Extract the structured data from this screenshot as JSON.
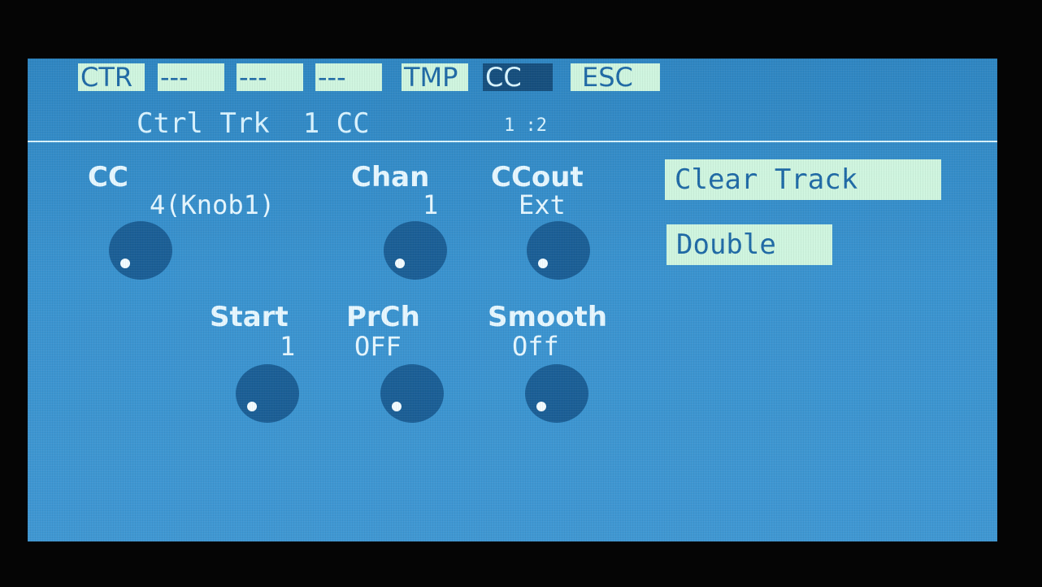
{
  "menu": [
    {
      "label": "CTR",
      "active": false
    },
    {
      "label": "---",
      "active": false
    },
    {
      "label": "---",
      "active": false
    },
    {
      "label": "---",
      "active": false
    },
    {
      "label": "TMP",
      "active": false
    },
    {
      "label": "CC",
      "active": true
    },
    {
      "label": "ESC",
      "active": false
    }
  ],
  "header": {
    "title": "Ctrl Trk  1 CC",
    "page": "1 :2"
  },
  "params": {
    "cc": {
      "label": "CC",
      "value": "4(Knob1)"
    },
    "chan": {
      "label": "Chan",
      "value": "1"
    },
    "ccout": {
      "label": "CCout",
      "value": "Ext"
    },
    "start": {
      "label": "Start",
      "value": "1"
    },
    "prch": {
      "label": "PrCh",
      "value": "OFF"
    },
    "smooth": {
      "label": "Smooth",
      "value": "Off"
    }
  },
  "buttons": {
    "clear_track": "Clear Track",
    "double": "Double"
  },
  "colors": {
    "screen": "#3a93cf",
    "menu_bg": "#cff5df",
    "menu_active": "#164f7e",
    "knob": "#1b5f96",
    "text": "#e6f7ff"
  }
}
